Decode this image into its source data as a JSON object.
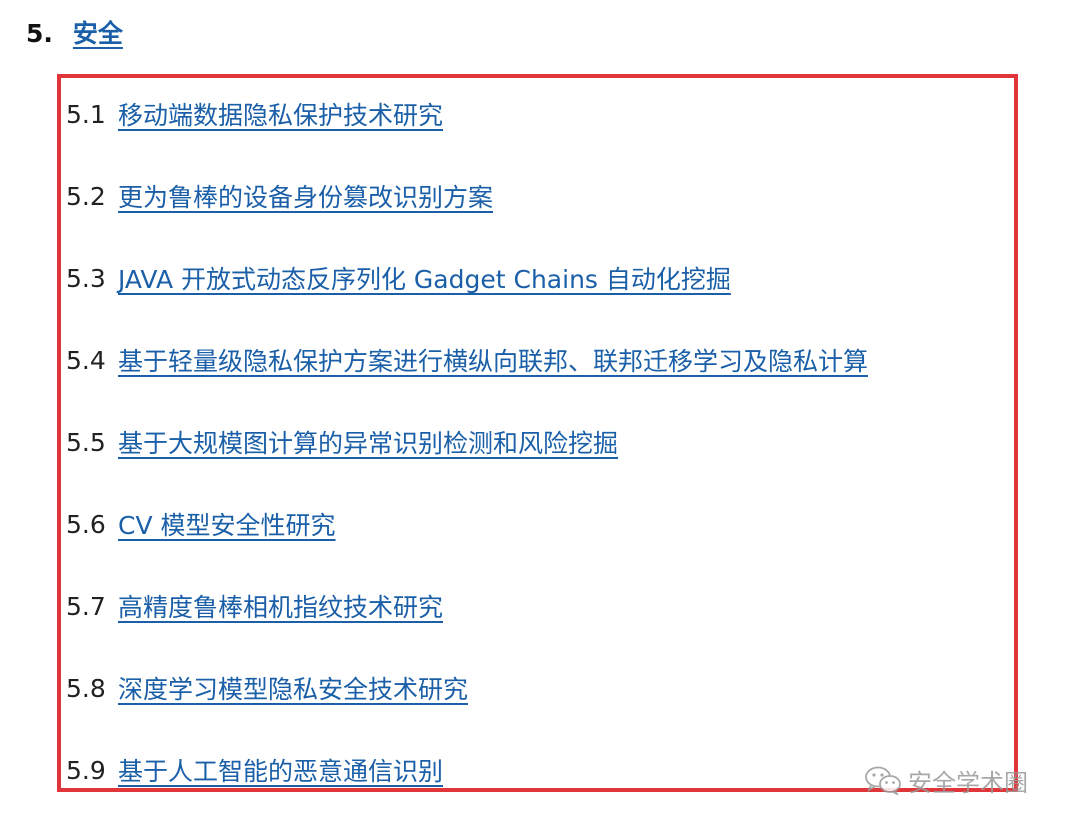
{
  "section": {
    "number": "5.",
    "title": "安全"
  },
  "toc": {
    "items": [
      {
        "num": "5.1",
        "label": "移动端数据隐私保护技术研究"
      },
      {
        "num": "5.2",
        "label": "更为鲁棒的设备身份篡改识别方案"
      },
      {
        "num": "5.3",
        "label": "JAVA  开放式动态反序列化 Gadget Chains 自动化挖掘"
      },
      {
        "num": "5.4",
        "label": "基于轻量级隐私保护方案进行横纵向联邦、联邦迁移学习及隐私计算"
      },
      {
        "num": "5.5",
        "label": "基于大规模图计算的异常识别检测和风险挖掘"
      },
      {
        "num": "5.6",
        "label": "CV 模型安全性研究"
      },
      {
        "num": "5.7",
        "label": "高精度鲁棒相机指纹技术研究"
      },
      {
        "num": "5.8",
        "label": "深度学习模型隐私安全技术研究"
      },
      {
        "num": "5.9",
        "label": "基于人工智能的恶意通信识别"
      }
    ]
  },
  "watermark": {
    "icon": "wechat-icon",
    "text": "安全学术圈"
  },
  "colors": {
    "link": "#1a5fa8",
    "frame": "#e0363a",
    "text": "#222222"
  }
}
